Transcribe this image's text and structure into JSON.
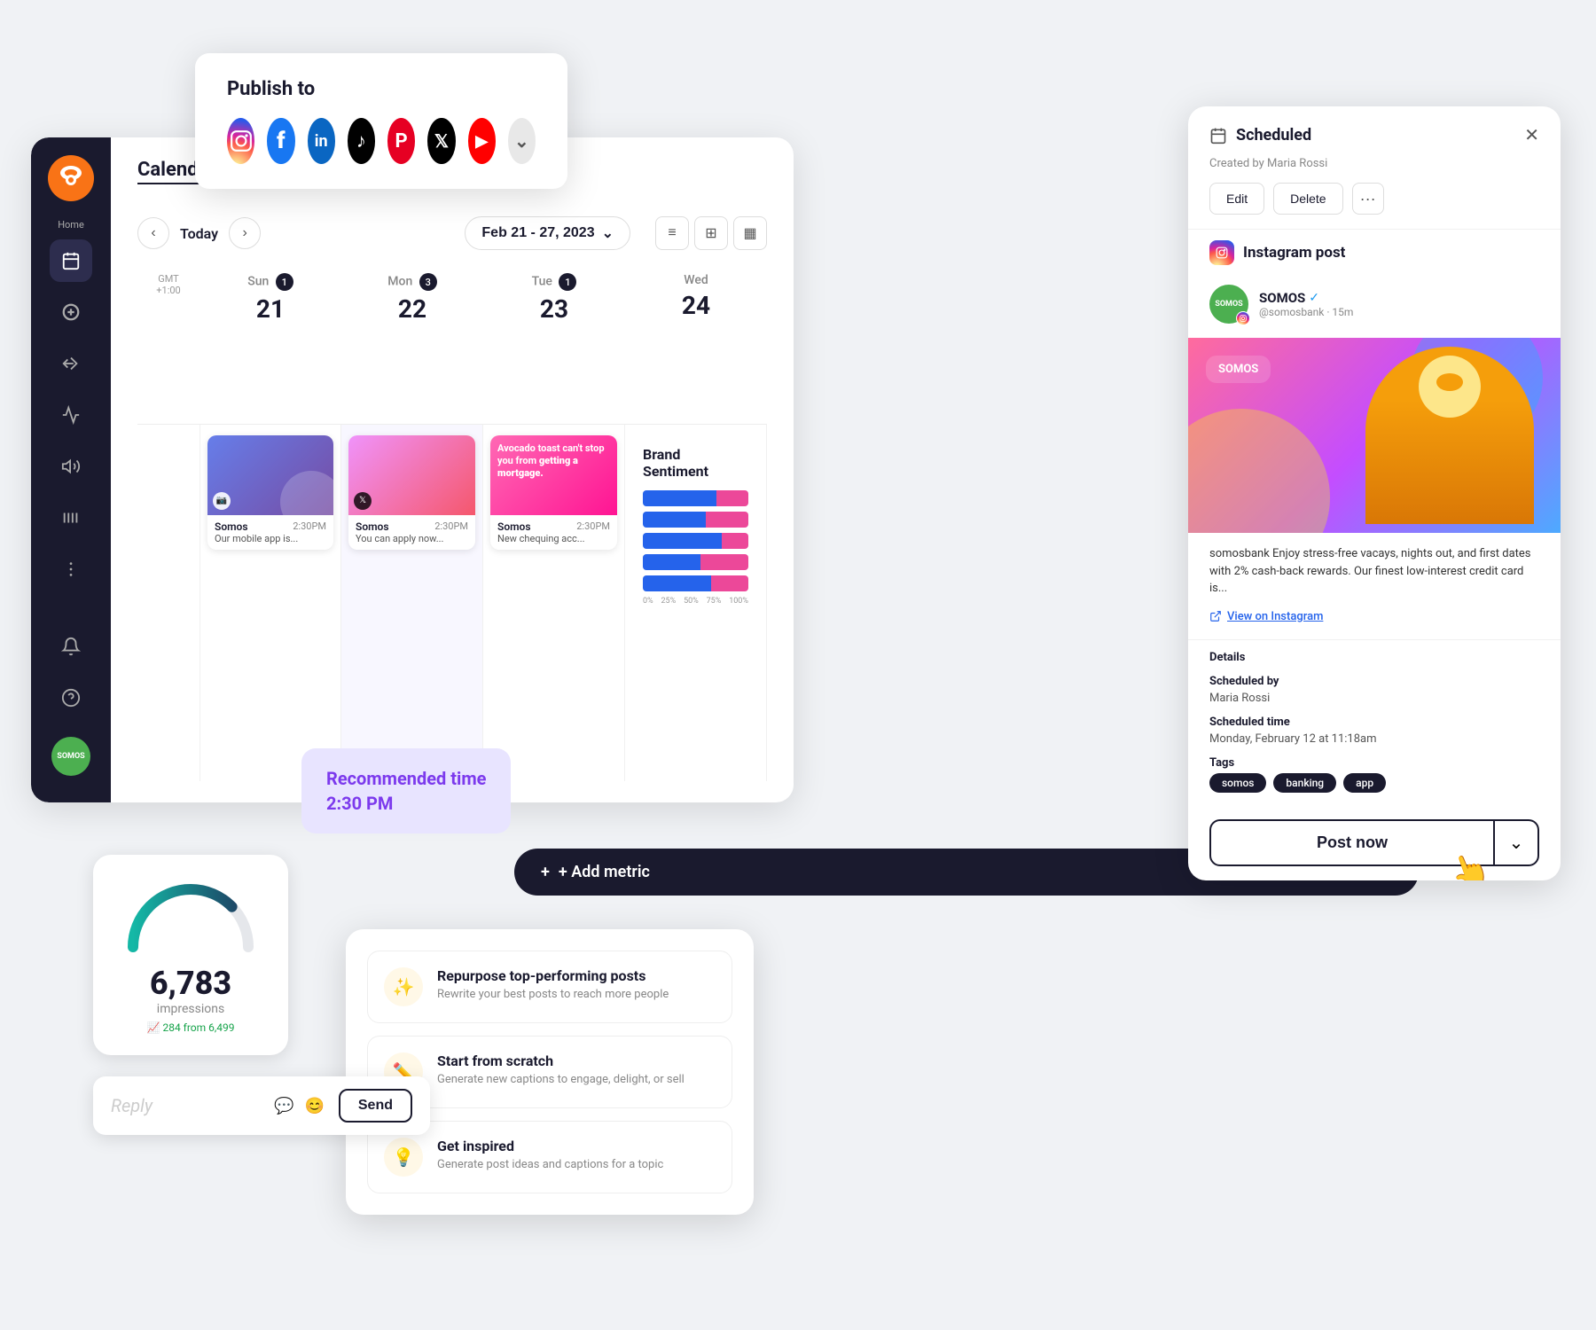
{
  "publish": {
    "title": "Publish to",
    "platforms": [
      {
        "name": "instagram",
        "label": "IG",
        "class": "si-instagram",
        "symbol": "📷"
      },
      {
        "name": "facebook",
        "label": "f",
        "class": "si-facebook",
        "symbol": "f"
      },
      {
        "name": "linkedin",
        "label": "in",
        "class": "si-linkedin",
        "symbol": "in"
      },
      {
        "name": "tiktok",
        "label": "♪",
        "class": "si-tiktok",
        "symbol": "♪"
      },
      {
        "name": "pinterest",
        "label": "P",
        "class": "si-pinterest",
        "symbol": "P"
      },
      {
        "name": "x",
        "label": "𝕏",
        "class": "si-x",
        "symbol": "𝕏"
      },
      {
        "name": "youtube",
        "label": "▶",
        "class": "si-youtube",
        "symbol": "▶"
      },
      {
        "name": "more",
        "label": "⌄",
        "class": "si-more",
        "symbol": "⌄"
      }
    ]
  },
  "sidebar": {
    "items": [
      {
        "name": "home",
        "label": "Home",
        "icon": "🏠",
        "active": false
      },
      {
        "name": "calendar",
        "label": "",
        "icon": "📅",
        "active": true
      },
      {
        "name": "compose",
        "label": "",
        "icon": "+",
        "active": false
      },
      {
        "name": "inbox",
        "label": "",
        "icon": "⬇",
        "active": false
      },
      {
        "name": "analytics",
        "label": "",
        "icon": "📊",
        "active": false
      },
      {
        "name": "campaigns",
        "label": "",
        "icon": "📢",
        "active": false
      },
      {
        "name": "streams",
        "label": "",
        "icon": "▎▎▎",
        "active": false
      },
      {
        "name": "more",
        "label": "",
        "icon": "···",
        "active": false
      },
      {
        "name": "notifications",
        "label": "",
        "icon": "🔔",
        "active": false
      },
      {
        "name": "help",
        "label": "",
        "icon": "?",
        "active": false
      }
    ],
    "avatar": "SOMOS"
  },
  "calendar": {
    "title": "Calendar",
    "nav": {
      "today": "Today",
      "date_range": "Feb 21 - 27, 2023"
    },
    "gmt": "GMT +1:00",
    "columns": [
      {
        "day": "Sun",
        "num": "21",
        "badge": "1",
        "today": false
      },
      {
        "day": "Mon",
        "num": "22",
        "badge": "3",
        "today": true
      },
      {
        "day": "Tue",
        "num": "23",
        "badge": "1",
        "today": false
      },
      {
        "day": "Wed",
        "num": "24",
        "badge": "",
        "today": false
      }
    ],
    "posts": {
      "sun": [
        {
          "platform": "ig",
          "account": "Somos",
          "time": "2:30PM",
          "text": "Our mobile app is..."
        }
      ],
      "mon": [
        {
          "platform": "x",
          "account": "Somos",
          "time": "2:30PM",
          "text": "You can apply now..."
        }
      ],
      "tue": [
        {
          "platform": "ig",
          "account": "Somos",
          "time": "2:30PM",
          "text": "New chequing acc..."
        }
      ]
    }
  },
  "avocado_post": {
    "text": "Avocado toast can't stop you from getting a mortgage."
  },
  "brand_sentiment": {
    "title": "Brand Sentiment",
    "bars": [
      {
        "blue": 70,
        "pink": 30
      },
      {
        "blue": 60,
        "pink": 40
      },
      {
        "blue": 75,
        "pink": 25
      },
      {
        "blue": 55,
        "pink": 45
      },
      {
        "blue": 65,
        "pink": 35
      }
    ],
    "axis": [
      "0%",
      "25%",
      "50%",
      "75%",
      "100%"
    ]
  },
  "recommended": {
    "text": "Recommended time\n2:30 PM"
  },
  "add_metric": {
    "label": "+ Add metric"
  },
  "impressions": {
    "number": "6,783",
    "label": "impressions",
    "change": "📈 284 from 6,499"
  },
  "reply_bar": {
    "placeholder": "Reply",
    "send_label": "Send"
  },
  "ai_tools": {
    "items": [
      {
        "icon": "✨",
        "title": "Repurpose top-performing posts",
        "description": "Rewrite your best posts to reach more people"
      },
      {
        "icon": "✏️",
        "title": "Start from scratch",
        "description": "Generate new captions to engage, delight, or sell"
      },
      {
        "icon": "💡",
        "title": "Get inspired",
        "description": "Generate post ideas and captions for a topic"
      }
    ]
  },
  "scheduled": {
    "title": "Scheduled",
    "created_by": "Created by Maria Rossi",
    "edit_label": "Edit",
    "delete_label": "Delete",
    "platform": "Instagram post",
    "account": {
      "name": "SOMOS",
      "handle": "@somosbank · 15m",
      "verified": true
    },
    "caption": "somosbank Enjoy stress-free vacays, nights out, and first dates with 2% cash-back rewards. Our finest low-interest credit card is...",
    "view_ig": "View on Instagram",
    "details": {
      "scheduled_by_label": "Scheduled by",
      "scheduled_by_value": "Maria Rossi",
      "scheduled_time_label": "Scheduled time",
      "scheduled_time_value": "Monday, February 12 at 11:18am",
      "tags_label": "Tags",
      "tags": [
        "somos",
        "banking",
        "app"
      ]
    },
    "post_now": "Post now"
  }
}
